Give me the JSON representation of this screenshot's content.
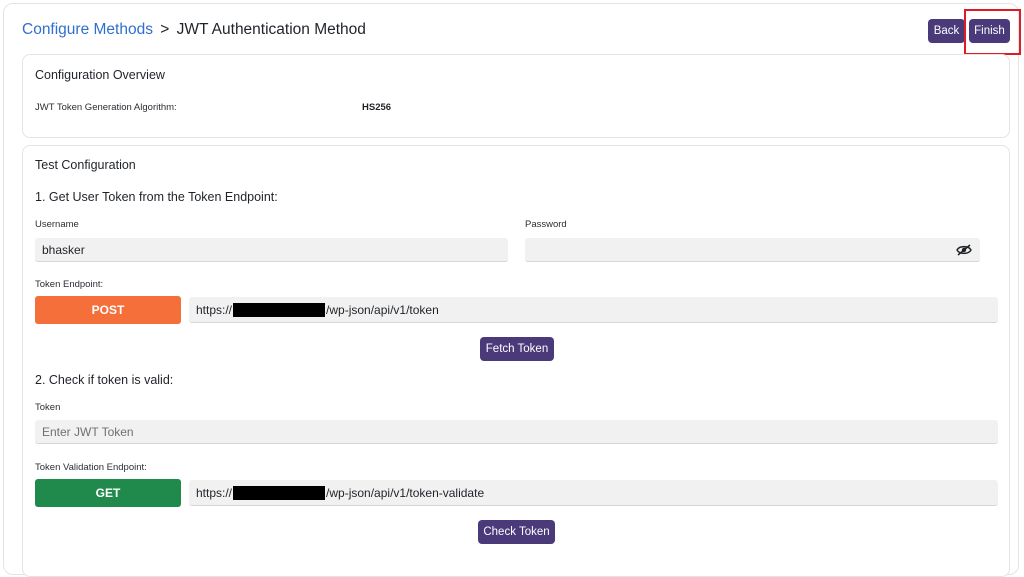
{
  "header": {
    "breadcrumb_link": "Configure Methods",
    "breadcrumb_separator": ">",
    "breadcrumb_current": "JWT Authentication Method",
    "back_label": "Back",
    "finish_label": "Finish"
  },
  "overview": {
    "title": "Configuration Overview",
    "algorithm_label": "JWT Token Generation Algorithm:",
    "algorithm_value": "HS256"
  },
  "test": {
    "title": "Test Configuration",
    "step1_heading": "1. Get User Token from the Token Endpoint:",
    "username_label": "Username",
    "username_value": "bhasker",
    "password_label": "Password",
    "password_value": "",
    "token_endpoint_label": "Token Endpoint:",
    "post_method": "POST",
    "token_url_prefix": "https://",
    "token_url_suffix": "/wp-json/api/v1/token",
    "fetch_label": "Fetch Token",
    "step2_heading": "2. Check if token is valid:",
    "token_label": "Token",
    "token_placeholder": "Enter JWT Token",
    "validation_endpoint_label": "Token Validation Endpoint:",
    "get_method": "GET",
    "validate_url_prefix": "https://",
    "validate_url_suffix": "/wp-json/api/v1/token-validate",
    "check_label": "Check Token"
  },
  "colors": {
    "accent_button": "#4a3a7a",
    "post_button": "#f46f3a",
    "get_button": "#1f8a4c",
    "link": "#2f6fcf",
    "highlight": "#e01b24"
  },
  "icons": {
    "password_toggle": "eye-slash-icon"
  }
}
